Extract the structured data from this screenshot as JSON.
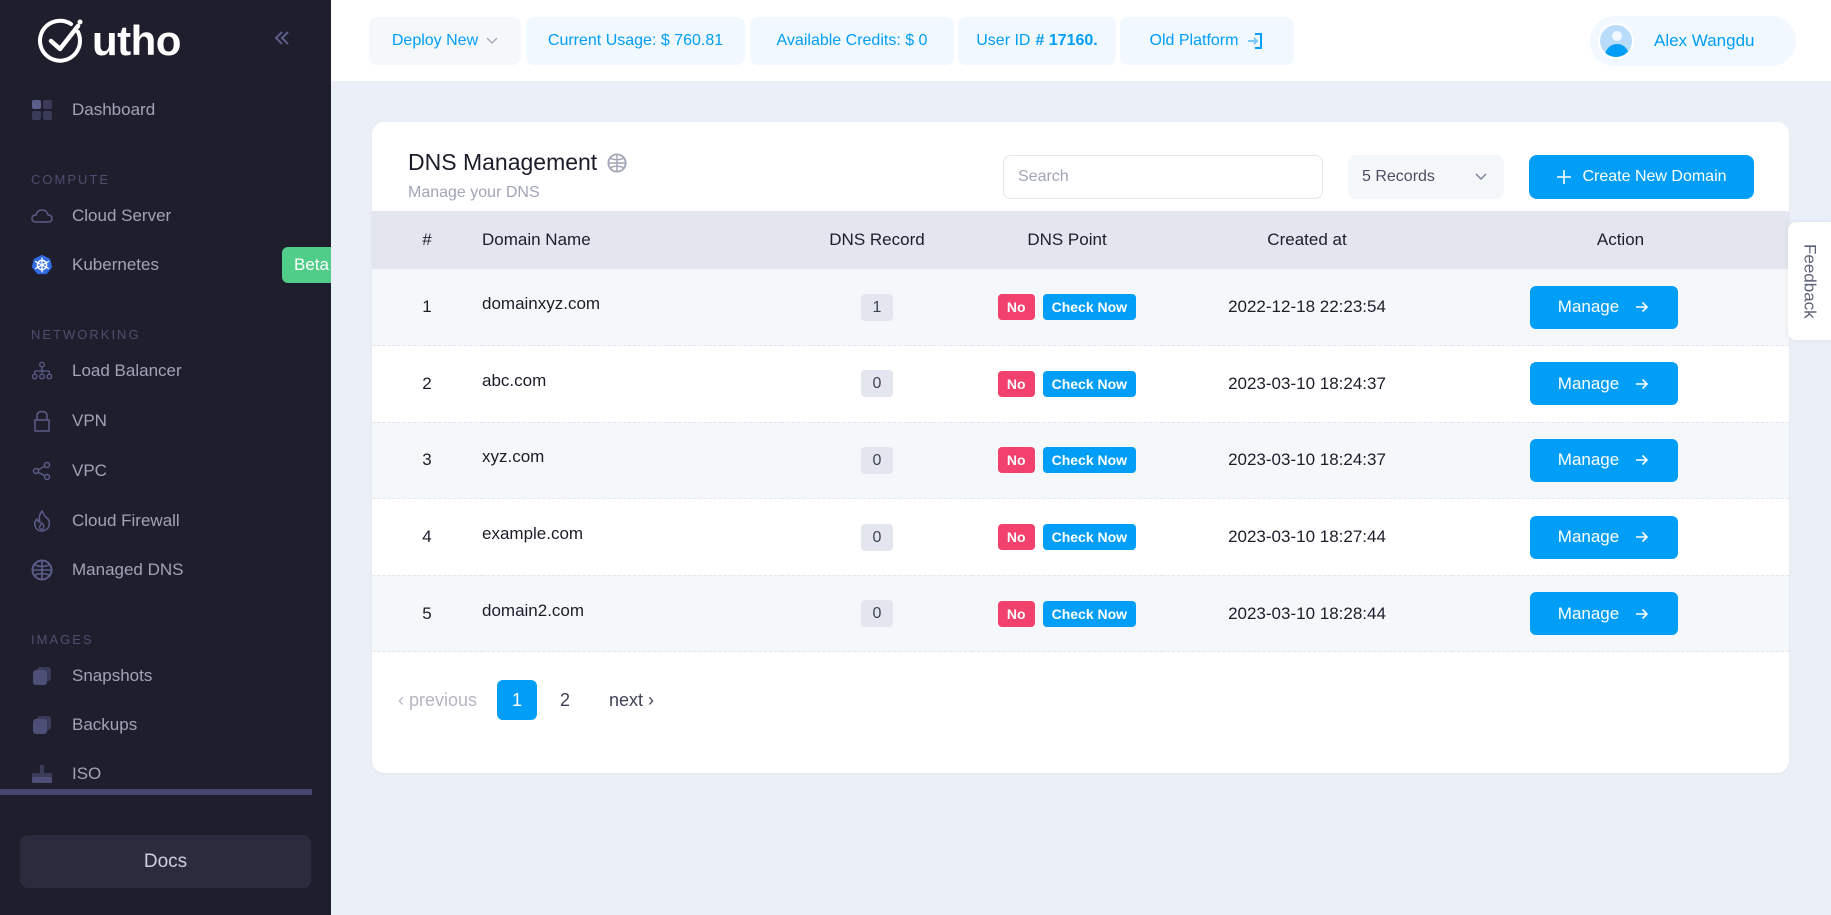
{
  "brand": {
    "name": "utho"
  },
  "sidebar": {
    "collapse_icon": "double-chevron-left-icon",
    "dashboard": {
      "label": "Dashboard",
      "icon": "dashboard-grid-icon"
    },
    "sections": [
      {
        "label": "COMPUTE",
        "items": [
          {
            "label": "Cloud Server",
            "icon": "cloud-icon"
          },
          {
            "label": "Kubernetes",
            "icon": "kubernetes-icon",
            "badge": "Beta"
          }
        ]
      },
      {
        "label": "NETWORKING",
        "items": [
          {
            "label": "Load Balancer",
            "icon": "network-icon"
          },
          {
            "label": "VPN",
            "icon": "lock-icon"
          },
          {
            "label": "VPC",
            "icon": "share-icon"
          },
          {
            "label": "Cloud Firewall",
            "icon": "fire-icon"
          },
          {
            "label": "Managed DNS",
            "icon": "globe-icon"
          }
        ]
      },
      {
        "label": "IMAGES",
        "items": [
          {
            "label": "Snapshots",
            "icon": "stack-icon"
          },
          {
            "label": "Backups",
            "icon": "stack-icon"
          },
          {
            "label": "ISO",
            "icon": "disc-drive-icon"
          }
        ]
      }
    ],
    "docs_label": "Docs"
  },
  "header": {
    "deploy_label": "Deploy New",
    "current_usage": "Current Usage: $ 760.81",
    "available_credits": "Available Credits: $ 0",
    "user_id_prefix": "User ID",
    "user_id_value": "# 17160.",
    "old_platform": "Old Platform",
    "user_name": "Alex Wangdu"
  },
  "page": {
    "title": "DNS Management",
    "subtitle": "Manage your DNS",
    "search_placeholder": "Search",
    "records_select": "5 Records",
    "create_button": "Create New Domain"
  },
  "table": {
    "columns": [
      "#",
      "Domain Name",
      "DNS Record",
      "DNS Point",
      "Created at",
      "Action"
    ],
    "rows": [
      {
        "num": "1",
        "domain": "domainxyz.com",
        "records": "1",
        "point": "No",
        "check": "Check Now",
        "created": "2022-12-18 22:23:54",
        "action": "Manage"
      },
      {
        "num": "2",
        "domain": "abc.com",
        "records": "0",
        "point": "No",
        "check": "Check Now",
        "created": "2023-03-10 18:24:37",
        "action": "Manage"
      },
      {
        "num": "3",
        "domain": "xyz.com",
        "records": "0",
        "point": "No",
        "check": "Check Now",
        "created": "2023-03-10 18:24:37",
        "action": "Manage"
      },
      {
        "num": "4",
        "domain": "example.com",
        "records": "0",
        "point": "No",
        "check": "Check Now",
        "created": "2023-03-10 18:27:44",
        "action": "Manage"
      },
      {
        "num": "5",
        "domain": "domain2.com",
        "records": "0",
        "point": "No",
        "check": "Check Now",
        "created": "2023-03-10 18:28:44",
        "action": "Manage"
      }
    ]
  },
  "pagination": {
    "previous": "‹ previous",
    "pages": [
      "1",
      "2"
    ],
    "current": "1",
    "next": "next ›"
  },
  "feedback_label": "Feedback",
  "colors": {
    "primary": "#009ef7",
    "danger": "#f1416c",
    "success": "#50cd89",
    "sidebar_bg": "#1e1e2d"
  }
}
